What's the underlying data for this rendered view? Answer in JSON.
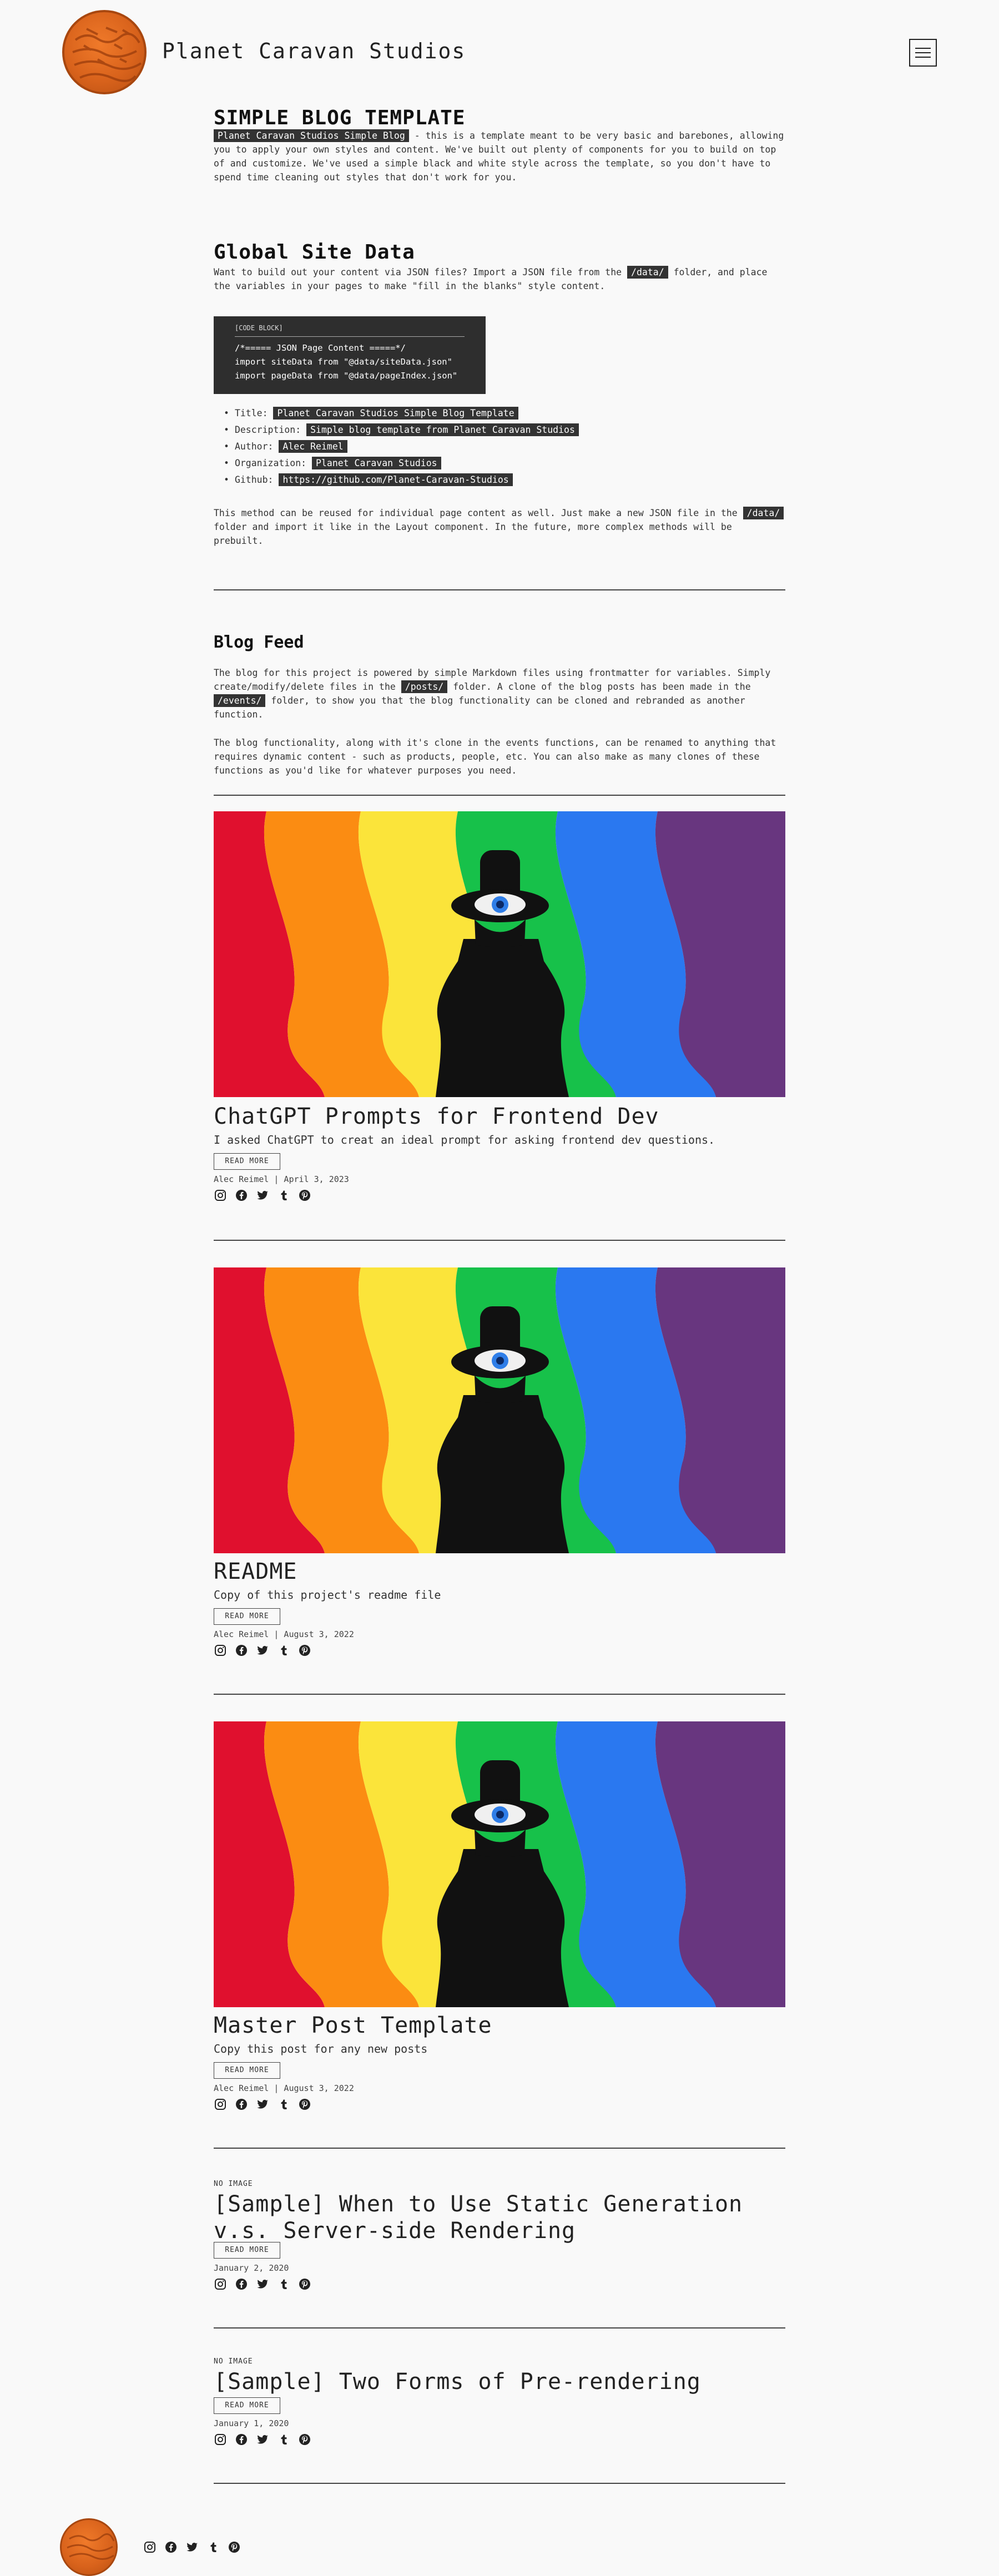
{
  "header": {
    "site_title": "Planet Caravan Studios",
    "logo_icon": "planet-caravan-logo",
    "menu_icon": "hamburger-menu-icon"
  },
  "intro": {
    "title": "SIMPLE BLOG TEMPLATE",
    "highlight": "Planet Caravan Studios Simple Blog",
    "text": " - this is a template meant to be very basic and barebones, allowing you to apply your own styles and content. We've built out plenty of components for you to build on top of and customize. We've used a simple black and white style across the template, so you don't have to spend time cleaning out styles that don't work for you."
  },
  "global_data": {
    "title": "Global Site Data",
    "text_before": "Want to build out your content via JSON files? Import a JSON file from the ",
    "folder": "/data/",
    "text_after": " folder, and place the variables in your pages to make \"fill in the blanks\" style content.",
    "code": {
      "label": "[CODE BLOCK]",
      "lines": [
        "/*===== JSON Page Content =====*/",
        "import siteData from \"@data/siteData.json\"",
        "import pageData from \"@data/pageIndex.json\""
      ]
    },
    "list": [
      {
        "key": "Title: ",
        "value": "Planet Caravan Studios Simple Blog Template"
      },
      {
        "key": "Description: ",
        "value": "Simple blog template from Planet Caravan Studios"
      },
      {
        "key": "Author: ",
        "value": "Alec Reimel"
      },
      {
        "key": "Organization: ",
        "value": "Planet Caravan Studios"
      },
      {
        "key": "Github: ",
        "value": "https://github.com/Planet-Caravan-Studios"
      }
    ],
    "reuse_before": "This method can be reused for individual page content as well. Just make a new JSON file in the ",
    "reuse_folder": "/data/",
    "reuse_after": " folder and import it like in the Layout component. In the future, more complex methods will be prebuilt."
  },
  "blog_feed": {
    "title": "Blog Feed",
    "p1_before": "The blog for this project is powered by simple Markdown files using frontmatter for variables. Simply create/modify/delete files in the ",
    "p1_posts": "/posts/",
    "p1_mid": " folder. A clone of the blog posts has been made in the ",
    "p1_events": "/events/",
    "p1_after": " folder, to show you that the blog functionality can be cloned and rebranded as another function.",
    "p2": "The blog functionality, along with it's clone in the events functions, can be renamed to anything that requires dynamic content - such as products, people, etc. You can also make as many clones of these functions as you'd like for whatever purposes you need."
  },
  "posts": [
    {
      "title": "ChatGPT Prompts for Frontend Dev",
      "desc": "I asked ChatGPT to creat an ideal prompt for asking frontend dev questions.",
      "button": "READ MORE",
      "meta": "Alec Reimel | April 3, 2023"
    },
    {
      "title": "README",
      "desc": "Copy of this project's readme file",
      "button": "READ MORE",
      "meta": "Alec Reimel | August 3, 2022"
    },
    {
      "title": "Master Post Template",
      "desc": "Copy this post for any new posts",
      "button": "READ MORE",
      "meta": "Alec Reimel | August 3, 2022"
    },
    {
      "no_image": "NO IMAGE",
      "title": "[Sample] When to Use Static Generation v.s. Server-side Rendering",
      "button": "READ MORE",
      "meta": "January 2, 2020"
    },
    {
      "no_image": "NO IMAGE",
      "title": "[Sample] Two Forms of Pre-rendering",
      "button": "READ MORE",
      "meta": "January 1, 2020"
    }
  ],
  "social_icons": [
    "instagram-icon",
    "facebook-icon",
    "twitter-icon",
    "tumblr-icon",
    "pinterest-icon"
  ],
  "rainbow_colors": [
    "#e0102e",
    "#fb8c12",
    "#fbe43a",
    "#17c14a",
    "#2a78f0",
    "#68367f"
  ]
}
